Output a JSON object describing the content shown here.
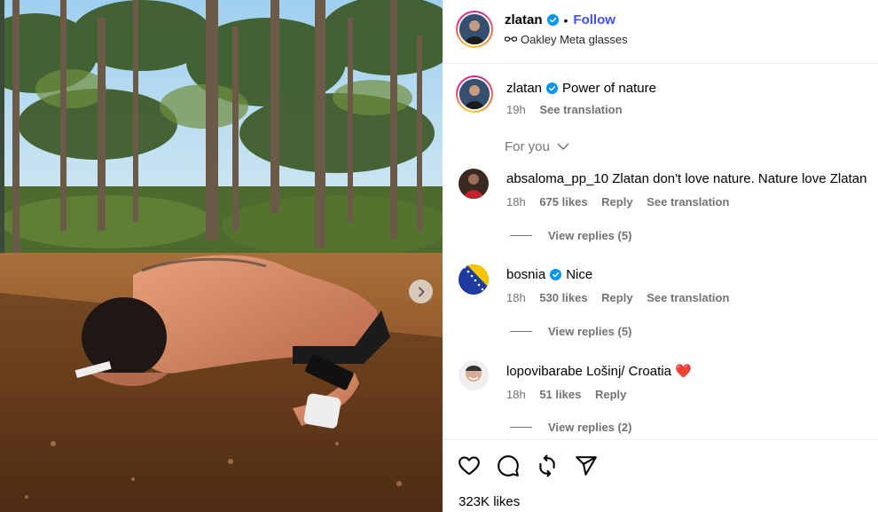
{
  "post": {
    "author": "zlatan",
    "follow_label": "Follow",
    "location": "Oakley Meta glasses",
    "caption": "Power of nature",
    "caption_time": "19h",
    "see_translation": "See translation",
    "likes_total": "323K likes"
  },
  "sort": {
    "label": "For you"
  },
  "comments": [
    {
      "user": "absaloma_pp_10",
      "text": "Zlatan don't love nature. Nature love Zlatan",
      "time": "18h",
      "likes": "675 likes",
      "reply": "Reply",
      "translate": "See translation",
      "replies": "View replies (5)"
    },
    {
      "user": "bosnia",
      "text": "Nice",
      "time": "18h",
      "likes": "530 likes",
      "reply": "Reply",
      "translate": "See translation",
      "replies": "View replies (5)"
    },
    {
      "user": "lopovibarabe",
      "text": "Lošinj/ Croatia ❤️",
      "time": "18h",
      "likes": "51 likes",
      "reply": "Reply",
      "replies": "View replies (2)"
    }
  ],
  "icons": [
    "heart-icon",
    "comment-icon",
    "repost-icon",
    "share-icon",
    "glasses-icon",
    "verified-icon",
    "chevron-right-icon"
  ],
  "colors": {
    "follow": "#4150f7",
    "verified": "#0095f6",
    "muted": "#737373",
    "heart": "#e8262f"
  }
}
